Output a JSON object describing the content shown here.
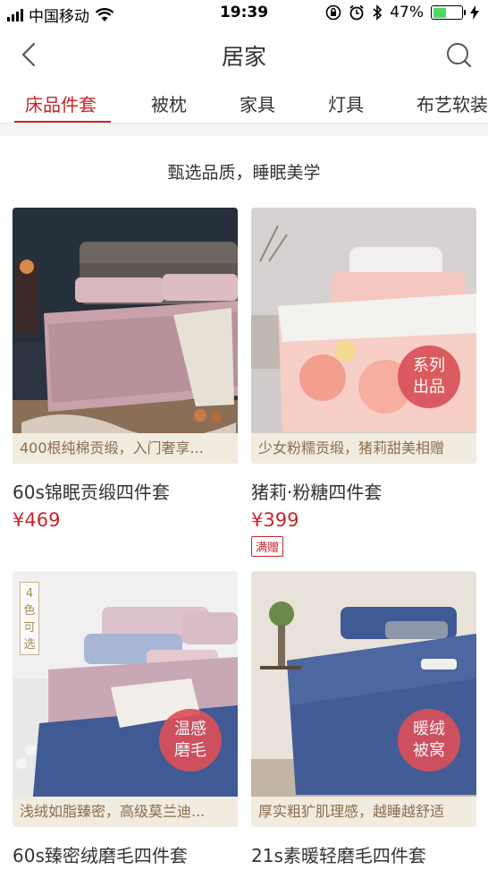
{
  "status_bar": {
    "carrier": "中国移动",
    "time": "19:39",
    "battery": "47%",
    "battery_level": 0.47
  },
  "nav": {
    "title": "居家"
  },
  "tabs": [
    {
      "label": "床品件套",
      "active": true
    },
    {
      "label": "被枕",
      "active": false
    },
    {
      "label": "家具",
      "active": false
    },
    {
      "label": "灯具",
      "active": false
    },
    {
      "label": "布艺软装",
      "active": false
    }
  ],
  "section": {
    "headline": "甄选品质，睡眠美学"
  },
  "products": [
    {
      "caption": "400根纯棉贡缎，入门奢享...",
      "name": "60s锦眠贡缎四件套",
      "price": "¥469"
    },
    {
      "caption": "少女粉糯贡缎，猪莉甜美相赠",
      "name": "猪莉·粉糖四件套",
      "price": "¥399",
      "badge_line1": "系列",
      "badge_line2": "出品",
      "gift_tag": "满赠"
    },
    {
      "caption": "浅绒如脂臻密，高级莫兰迪...",
      "name": "60s臻密绒磨毛四件套",
      "badge_line1": "温感",
      "badge_line2": "磨毛",
      "side_tag": [
        "4",
        "色",
        "可",
        "选"
      ]
    },
    {
      "caption": "厚实粗犷肌理感，越睡越舒适",
      "name": "21s素暖轻磨毛四件套",
      "badge_line1": "暖绒",
      "badge_line2": "被窝"
    }
  ],
  "colors": {
    "accent": "#c6262b",
    "caption_bg": "#f1ebe0",
    "caption_text": "#8b6e4e",
    "badge": "#d9505a"
  }
}
